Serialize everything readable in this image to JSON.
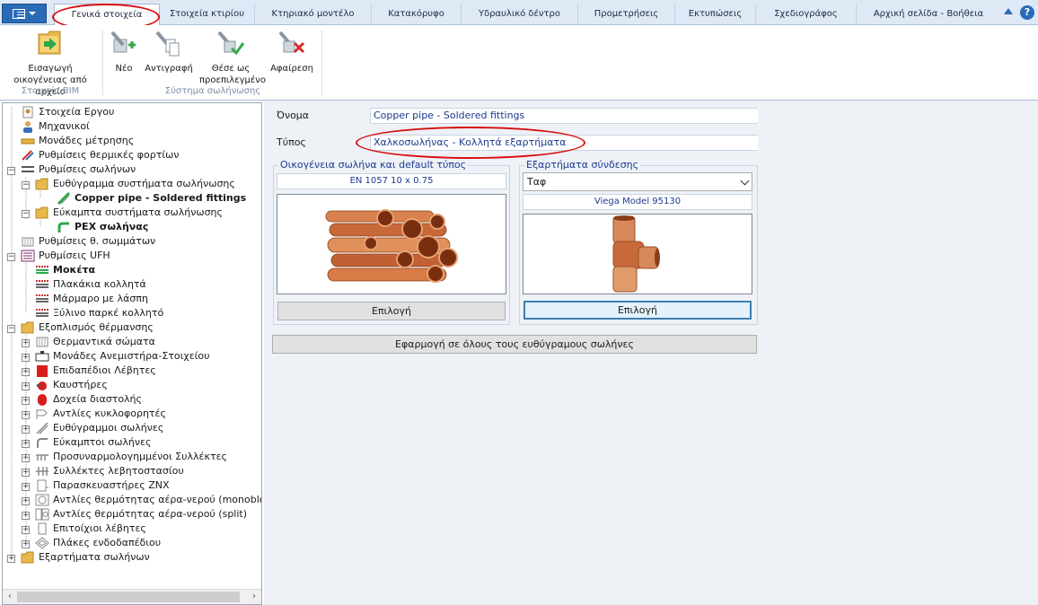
{
  "tabs": [
    {
      "label": "Γενικά στοιχεία",
      "active": true
    },
    {
      "label": "Στοιχεία κτιρίου"
    },
    {
      "label": "Κτηριακό μοντέλο"
    },
    {
      "label": "Κατακόρυφο"
    },
    {
      "label": "Υδραυλικό δέντρο"
    },
    {
      "label": "Προμετρήσεις"
    },
    {
      "label": "Εκτυπώσεις"
    },
    {
      "label": "Σχεδιογράφος"
    },
    {
      "label": "Αρχική σελίδα - Βοήθεια"
    }
  ],
  "help_label": "?",
  "ribbon": {
    "import_family": "Εισαγωγή οικογένειας από αρχείο",
    "group_bim": "Στοιχεία BIM",
    "new": "Νέο",
    "copy": "Αντιγραφή",
    "set_default": "Θέσε ως προεπιλεγμένο",
    "remove": "Αφαίρεση",
    "group_piping": "Σύστημα σωλήνωσης"
  },
  "tree": {
    "items": [
      {
        "label": "Στοιχεία Εργου"
      },
      {
        "label": "Μηχανικοί"
      },
      {
        "label": "Μονάδες μέτρησης"
      },
      {
        "label": "Ρυθμίσεις θερμικές φορτίων"
      },
      {
        "label": "Ρυθμίσεις σωλήνων"
      },
      {
        "label": "Ευθύγραμμα συστήματα σωλήνωσης"
      },
      {
        "label": "Copper pipe - Soldered fittings"
      },
      {
        "label": "Εύκαμπτα συστήματα σωλήνωσης"
      },
      {
        "label": "PEX σωλήνας"
      },
      {
        "label": "Ρυθμίσεις θ. σωμμάτων"
      },
      {
        "label": "Ρυθμίσεις UFH"
      },
      {
        "label": "Μοκέτα"
      },
      {
        "label": "Πλακάκια κολλητά"
      },
      {
        "label": "Μάρμαρο με λάσπη"
      },
      {
        "label": "Ξύλινο παρκέ κολλητό"
      },
      {
        "label": "Εξοπλισμός θέρμανσης"
      },
      {
        "label": "Θερμαντικά σώματα"
      },
      {
        "label": "Μονάδες Ανεμιστήρα-Στοιχείου"
      },
      {
        "label": "Επιδαπέδιοι Λέβητες"
      },
      {
        "label": "Καυστήρες"
      },
      {
        "label": "Δοχεία διαστολής"
      },
      {
        "label": "Αντλίες κυκλοφορητές"
      },
      {
        "label": "Ευθύγραμμοι σωλήνες"
      },
      {
        "label": "Εύκαμπτοι σωλήνες"
      },
      {
        "label": "Προσυναρμολογημμένοι Συλλέκτες"
      },
      {
        "label": "Συλλέκτες λεβητοστασίου"
      },
      {
        "label": "Παρασκευαστήρες ΖΝΧ"
      },
      {
        "label": "Αντλίες θερμότητας αέρα-νερού (monobloc"
      },
      {
        "label": "Αντλίες θερμότητας αέρα-νερού (split)"
      },
      {
        "label": "Επιτοίχιοι λέβητες"
      },
      {
        "label": "Πλάκες ενδοδαπέδιου"
      },
      {
        "label": "Εξαρτήματα σωλήνων"
      }
    ]
  },
  "form": {
    "name_label": "Όνομα",
    "name_value": "Copper pipe - Soldered fittings",
    "type_label": "Τύπος",
    "type_value": "Χαλκοσωλήνας - Κολλητά εξαρτήματα",
    "family_group_title": "Οικογένεια σωλήνα και default τύπος",
    "family_value": "EN 1057 10 x 0.75",
    "family_select_button": "Επιλογή",
    "fittings_group_title": "Εξαρτήματα σύνδεσης",
    "fitting_option": "Ταφ",
    "fitting_model": "Viega Model 95130",
    "fitting_select_button": "Επιλογή",
    "apply_all_button": "Εφαρμογή σε όλους τους ευθύγραμους σωλήνες"
  },
  "colors": {
    "accent": "#2a6bb8",
    "annotation_red": "#d80e0e",
    "value_text": "#1b3a8f",
    "copper": "#c8693a"
  }
}
